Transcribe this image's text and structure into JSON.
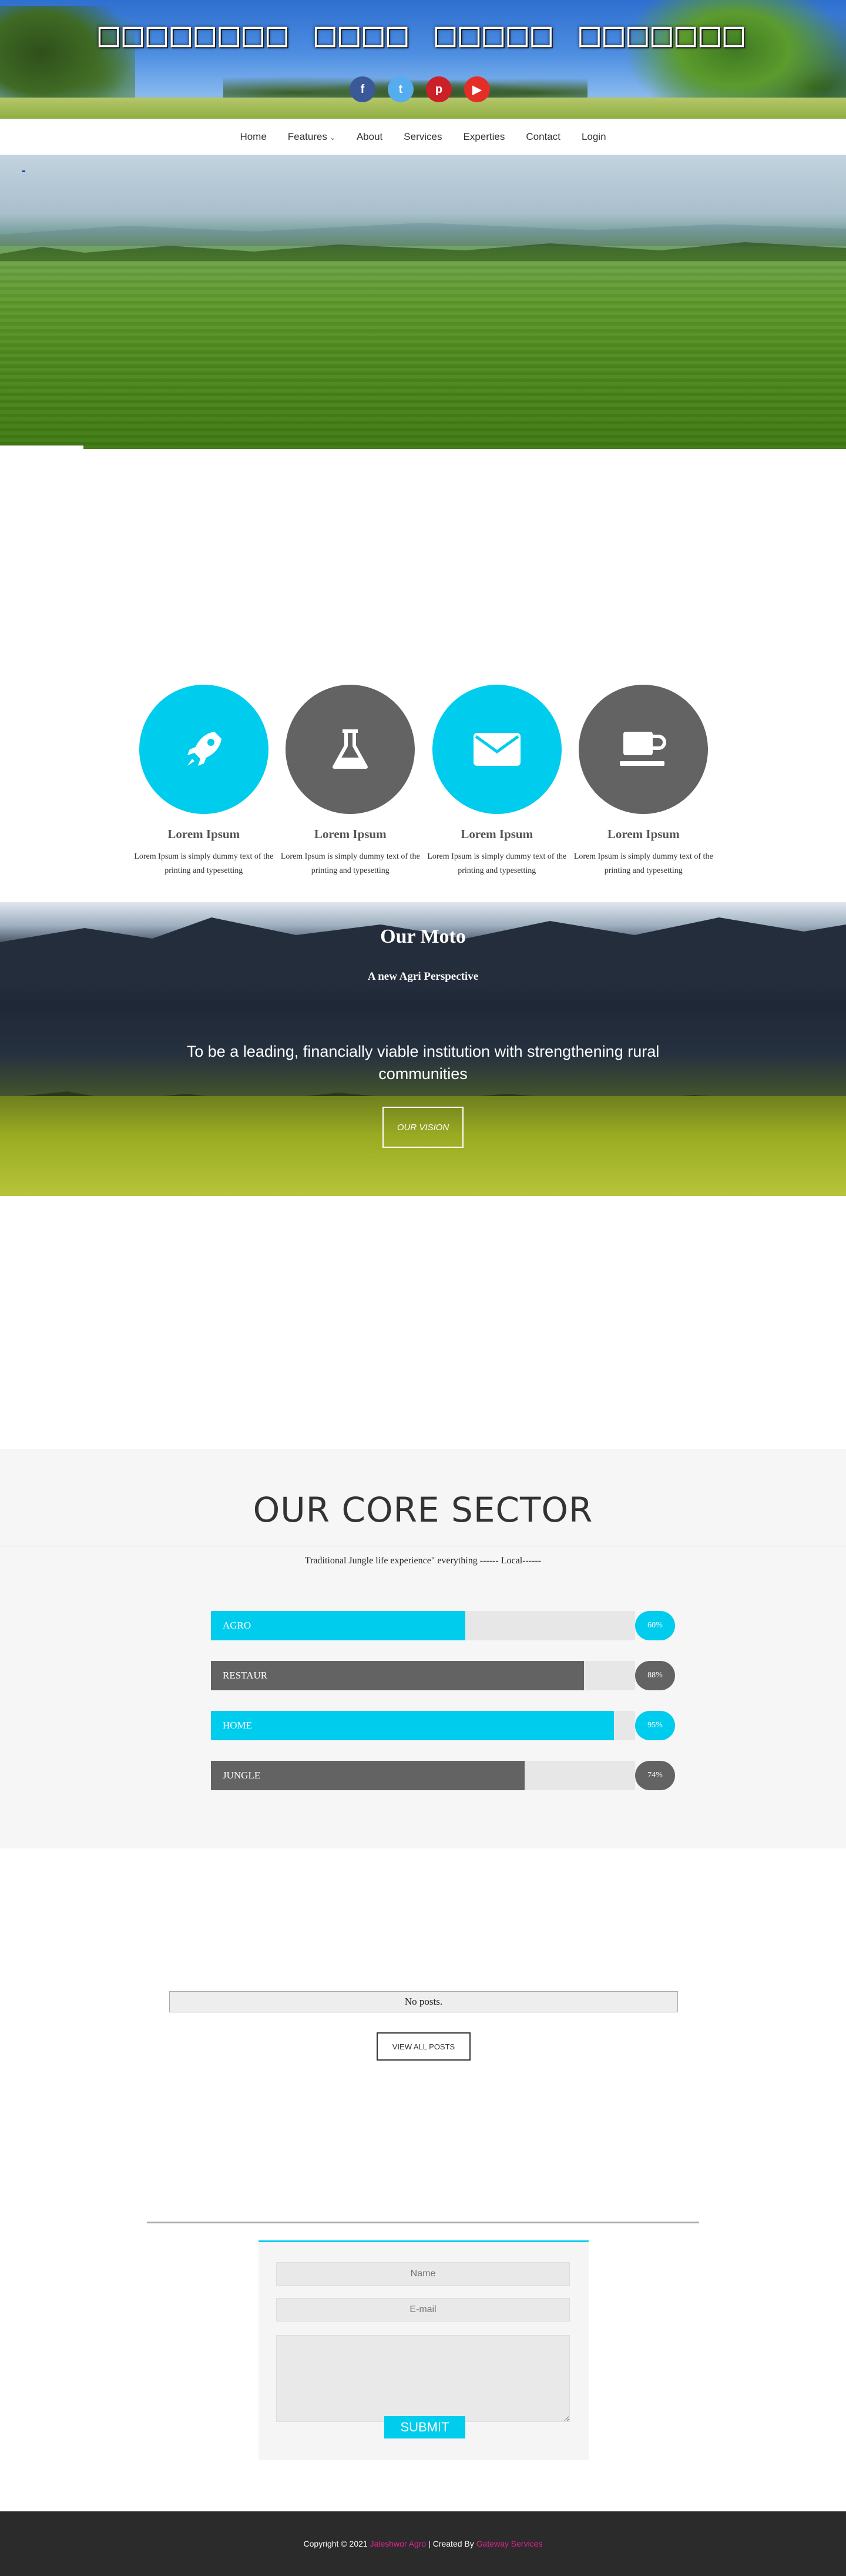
{
  "site": {
    "title": "□□□□□□□□ □□□□ □□□□□ □□□□□□□",
    "socials": [
      {
        "name": "facebook",
        "glyph": "f",
        "color": "#3b5998"
      },
      {
        "name": "twitter",
        "glyph": "t",
        "color": "#55acee"
      },
      {
        "name": "pinterest",
        "glyph": "p",
        "color": "#cb2027"
      },
      {
        "name": "youtube",
        "glyph": "▶",
        "color": "#e52d27"
      }
    ]
  },
  "nav": {
    "items": [
      "Home",
      "Features",
      "About",
      "Services",
      "Experties",
      "Contact",
      "Login"
    ],
    "features_caret": "⌄"
  },
  "features": [
    {
      "icon": "rocket-icon",
      "color": "#00ccee",
      "title": "Lorem Ipsum",
      "text": "Lorem Ipsum is simply dummy text of the printing and typesetting"
    },
    {
      "icon": "flask-icon",
      "color": "#636363",
      "title": "Lorem Ipsum",
      "text": "Lorem Ipsum is simply dummy text of the printing and typesetting"
    },
    {
      "icon": "envelope-icon",
      "color": "#00ccee",
      "title": "Lorem Ipsum",
      "text": "Lorem Ipsum is simply dummy text of the printing and typesetting"
    },
    {
      "icon": "coffee-icon",
      "color": "#636363",
      "title": "Lorem Ipsum",
      "text": "Lorem Ipsum is simply dummy text of the printing and typesetting"
    }
  ],
  "moto": {
    "title": "Our Moto",
    "subtitle": "A new Agri Perspective",
    "text": "To be a leading, financially viable institution with strengthening rural communities",
    "button": "OUR VISION"
  },
  "core": {
    "title": "OUR CORE SECTOR",
    "subtitle": "Traditional Jungle life experience\" everything ------ Local------",
    "skills": [
      {
        "label": "AGRO",
        "percent": 60,
        "badge": "60%",
        "color": "#00ccee"
      },
      {
        "label": "RESTAUR",
        "percent": 88,
        "badge": "88%",
        "color": "#636363"
      },
      {
        "label": "HOME",
        "percent": 95,
        "badge": "95%",
        "color": "#00ccee"
      },
      {
        "label": "JUNGLE",
        "percent": 74,
        "badge": "74%",
        "color": "#636363"
      }
    ]
  },
  "posts": {
    "empty": "No posts.",
    "view_all": "VIEW ALL POSTS"
  },
  "contact": {
    "name_placeholder": "Name",
    "email_placeholder": "E-mail",
    "submit": "SUBMIT"
  },
  "footer": {
    "copyright": "Copyright © 2021",
    "brand": "Jaleshwor Agro",
    "separator": "| Created By",
    "creator": "Gateway Services"
  },
  "colors": {
    "accent": "#00ccee",
    "gray": "#636363",
    "footer_link": "#e2228f"
  }
}
